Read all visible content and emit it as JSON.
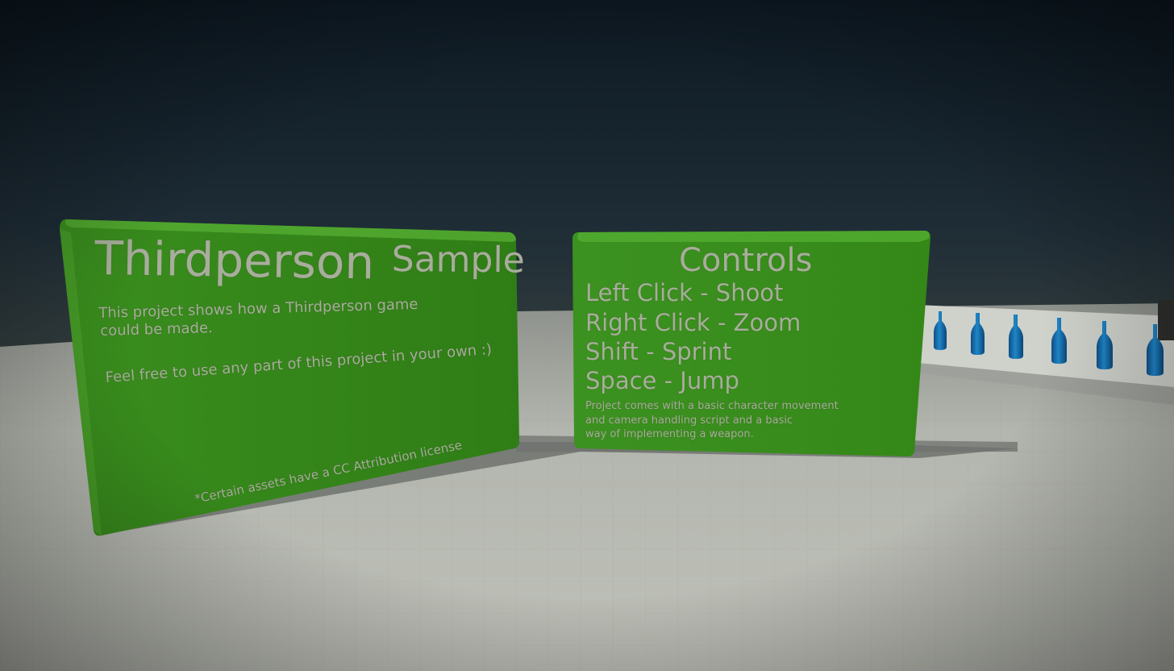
{
  "left_sign": {
    "title_main": "Thirdperson",
    "title_secondary": "Sample",
    "description_line_1": "This project shows how a Thirdperson game",
    "description_line_2": "could be made.",
    "description_line_3": "Feel free to use any part of this project in your own :)",
    "license_note": "*Certain assets have a CC Attribution license"
  },
  "right_sign": {
    "title": "Controls",
    "controls": [
      "Left Click - Shoot",
      "Right Click - Zoom",
      "Shift - Sprint",
      "Space - Jump"
    ],
    "note_lines": [
      "Project comes with a basic character movement",
      "and camera handling script and a basic",
      "way of implementing a weapon."
    ]
  },
  "colors": {
    "sign_green": "#3e9421",
    "sign_text": "#a8ad9c",
    "ground": "#b9bcb4",
    "bottle_blue": "#1a73b5"
  },
  "bottles": {
    "count": 6,
    "icon": "bottle-icon"
  }
}
